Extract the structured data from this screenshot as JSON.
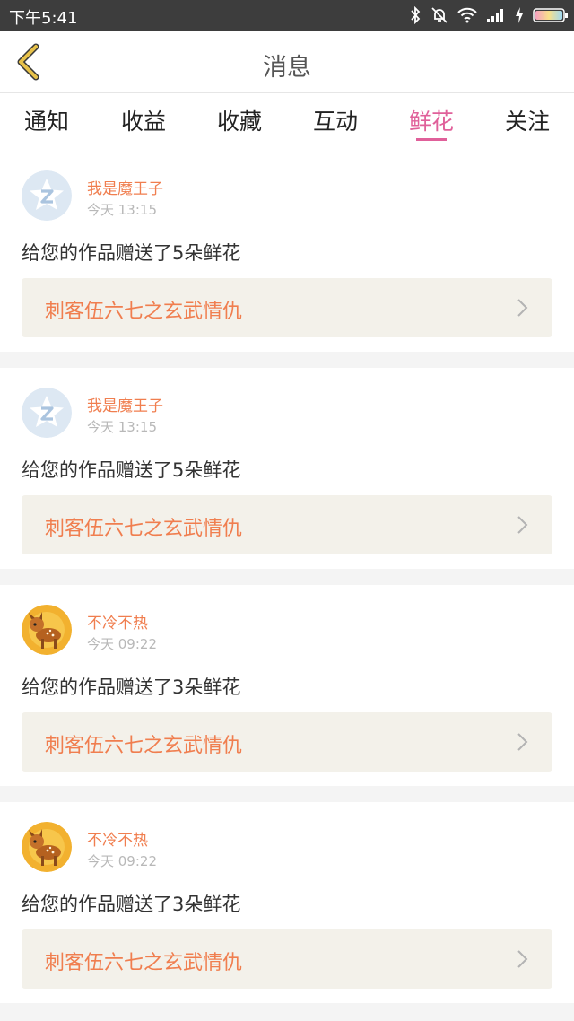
{
  "status_bar": {
    "time": "下午5:41"
  },
  "header": {
    "title": "消息"
  },
  "tabs": [
    {
      "label": "通知",
      "active": false
    },
    {
      "label": "收益",
      "active": false
    },
    {
      "label": "收藏",
      "active": false
    },
    {
      "label": "互动",
      "active": false
    },
    {
      "label": "鲜花",
      "active": true
    },
    {
      "label": "关注",
      "active": false
    }
  ],
  "messages": [
    {
      "sender": "我是魔王子",
      "time": "今天 13:15",
      "text": "给您的作品赠送了5朵鲜花",
      "work_title": "刺客伍六七之玄武情仇",
      "avatar": "default-qq-avatar"
    },
    {
      "sender": "我是魔王子",
      "time": "今天 13:15",
      "text": "给您的作品赠送了5朵鲜花",
      "work_title": "刺客伍六七之玄武情仇",
      "avatar": "default-qq-avatar"
    },
    {
      "sender": "不冷不热",
      "time": "今天 09:22",
      "text": "给您的作品赠送了3朵鲜花",
      "work_title": "刺客伍六七之玄武情仇",
      "avatar": "fawn-avatar"
    },
    {
      "sender": "不冷不热",
      "time": "今天 09:22",
      "text": "给您的作品赠送了3朵鲜花",
      "work_title": "刺客伍六七之玄武情仇",
      "avatar": "fawn-avatar"
    }
  ],
  "colors": {
    "accent": "#e0609a",
    "sender": "#f07e4f",
    "back_arrow": "#e8c24a",
    "status_bar": "#3d3d3d"
  }
}
